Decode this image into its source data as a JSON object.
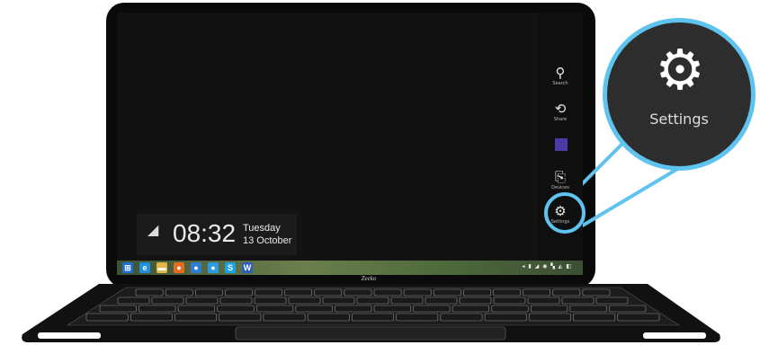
{
  "lockscreen": {
    "time": "08:32",
    "day": "Tuesday",
    "date": "13 October"
  },
  "charms": [
    {
      "name": "search",
      "icon": "search-icon",
      "label": "Search",
      "glyph": "⚲"
    },
    {
      "name": "share",
      "icon": "share-icon",
      "label": "Share",
      "glyph": "⟲"
    },
    {
      "name": "start",
      "icon": "windows-start-icon",
      "label": "Start",
      "glyph": ""
    },
    {
      "name": "devices",
      "icon": "devices-icon",
      "label": "Devices",
      "glyph": "⎘"
    },
    {
      "name": "settings",
      "icon": "gear-icon",
      "label": "Settings",
      "glyph": "⚙"
    }
  ],
  "zoom": {
    "label": "Settings",
    "glyph": "⚙"
  },
  "taskbar": {
    "icons": [
      {
        "name": "windows-start-icon",
        "glyph": "⊞",
        "color": "#1e6fd9"
      },
      {
        "name": "internet-explorer-icon",
        "glyph": "e",
        "color": "#1f8fe0"
      },
      {
        "name": "file-explorer-icon",
        "glyph": "▬",
        "color": "#e0b84b"
      },
      {
        "name": "firefox-icon",
        "glyph": "●",
        "color": "#e66a1f"
      },
      {
        "name": "app-icon-blue-1",
        "glyph": "●",
        "color": "#2f7bd1"
      },
      {
        "name": "app-icon-blue-2",
        "glyph": "●",
        "color": "#2b9be3"
      },
      {
        "name": "skype-icon",
        "glyph": "S",
        "color": "#1aa3e8"
      },
      {
        "name": "word-icon",
        "glyph": "W",
        "color": "#2b5fb8"
      }
    ],
    "tray": "◂ ▮ ◢ ◉ ▚ ◭ ◧"
  },
  "brand": "Zeeko",
  "colors": {
    "accent": "#5ec3ee",
    "screen": "#121212",
    "zoom_bg": "#2d2d2d"
  }
}
